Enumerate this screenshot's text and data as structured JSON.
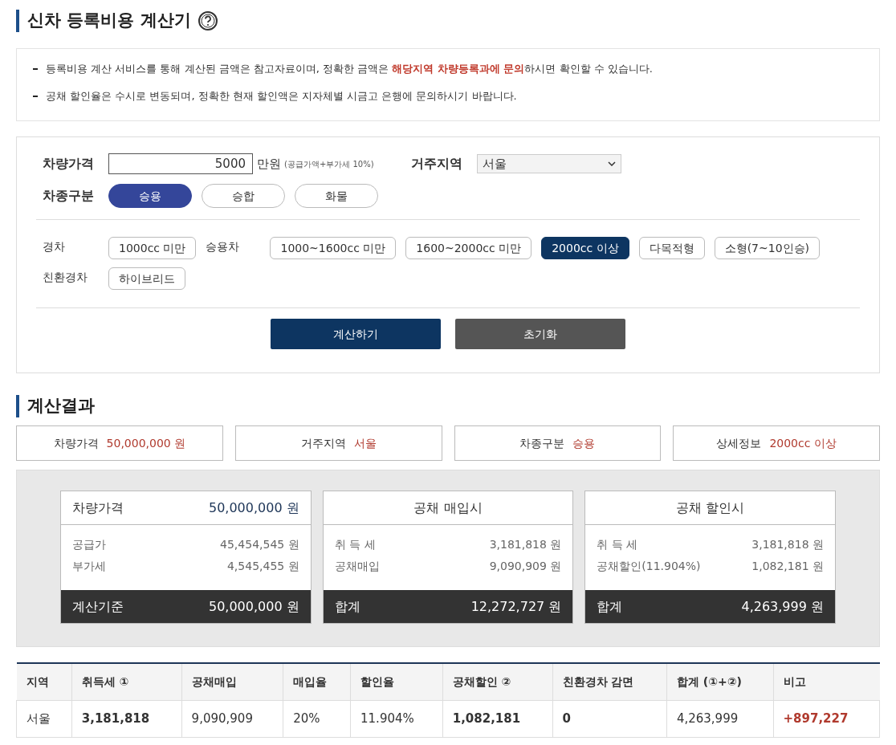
{
  "title": "신차 등록비용 계산기",
  "notices": [
    {
      "text": "등록비용 계산 서비스를 통해 계산된 금액은 참고자료이며, 정확한 금액은 **해당지역 차량등록과에 문의**하시면 확인할 수 있습니다."
    },
    {
      "text": "공채 할인율은 수시로 변동되며, 정확한 현재 할인액은 지자체별 시금고 은행에 문의하시기 바랍니다."
    }
  ],
  "form": {
    "price_label": "차량가격",
    "price_value": "5000",
    "price_unit": "만원",
    "price_note": "(공급가액+부가세 10%)",
    "region_label": "거주지역",
    "region_value": "서울",
    "type_label": "차종구분",
    "vehicle_types": [
      {
        "label": "승용",
        "selected": true
      },
      {
        "label": "승합",
        "selected": false
      },
      {
        "label": "화물",
        "selected": false
      }
    ],
    "category_rows": [
      [
        {
          "label": "경차",
          "options": [
            {
              "label": "1000cc 미만",
              "selected": false
            }
          ]
        },
        {
          "label": "승용차",
          "options": [
            {
              "label": "1000~1600cc 미만",
              "selected": false
            },
            {
              "label": "1600~2000cc 미만",
              "selected": false
            },
            {
              "label": "2000cc 이상",
              "selected": true
            },
            {
              "label": "다목적형",
              "selected": false
            },
            {
              "label": "소형(7~10인승)",
              "selected": false
            }
          ]
        }
      ],
      [
        {
          "label": "친환경차",
          "options": [
            {
              "label": "하이브리드",
              "selected": false
            }
          ]
        }
      ]
    ],
    "buttons": [
      {
        "label": "계산하기",
        "kind": "primary"
      },
      {
        "label": "초기화",
        "kind": "secondary"
      }
    ]
  },
  "results_title": "계산결과",
  "summary": [
    {
      "label": "차량가격",
      "value": "50,000,000 원"
    },
    {
      "label": "거주지역",
      "value": "서울"
    },
    {
      "label": "차종구분",
      "value": "승용"
    },
    {
      "label": "상세정보",
      "value": "2000cc 이상"
    }
  ],
  "cards": [
    {
      "kind": "price",
      "header": "차량가격",
      "header_value": "50,000,000 원",
      "rows": [
        {
          "label": "공급가",
          "value": "45,454,545 원"
        },
        {
          "label": "부가세",
          "value": "4,545,455 원"
        }
      ],
      "total_label": "계산기준",
      "total_value": "50,000,000 원"
    },
    {
      "kind": "centered",
      "header": "공채 매입시",
      "rows": [
        {
          "label": "취 득 세",
          "value": "3,181,818 원"
        },
        {
          "label": "공채매입",
          "value": "9,090,909 원"
        }
      ],
      "total_label": "합계",
      "total_value": "12,272,727 원"
    },
    {
      "kind": "centered",
      "header": "공채 할인시",
      "rows": [
        {
          "label": "취 득 세",
          "value": "3,181,818 원"
        },
        {
          "label": "공채할인(11.904%)",
          "value": "1,082,181 원"
        }
      ],
      "total_label": "합계",
      "total_value": "4,263,999 원"
    }
  ],
  "table": {
    "columns": [
      "지역",
      "취득세 ①",
      "공채매입",
      "매입율",
      "할인율",
      "공채할인 ②",
      "친환경차 감면",
      "합계 (①+②)",
      "비고"
    ],
    "rows": [
      {
        "cells": [
          {
            "text": "서울",
            "bold": false,
            "highlight": false
          },
          {
            "text": "3,181,818",
            "bold": true,
            "highlight": false
          },
          {
            "text": "9,090,909",
            "bold": false,
            "highlight": false
          },
          {
            "text": "20%",
            "bold": false,
            "highlight": false
          },
          {
            "text": "11.904%",
            "bold": false,
            "highlight": false
          },
          {
            "text": "1,082,181",
            "bold": true,
            "highlight": false
          },
          {
            "text": "0",
            "bold": true,
            "highlight": false
          },
          {
            "text": "4,263,999",
            "bold": false,
            "highlight": false
          },
          {
            "text": "+897,227",
            "bold": true,
            "highlight": true
          }
        ]
      }
    ]
  }
}
